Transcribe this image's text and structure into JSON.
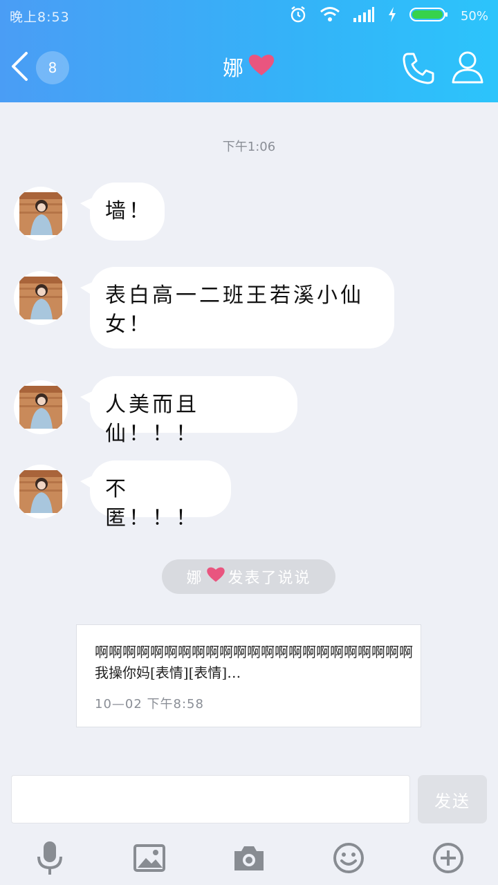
{
  "status": {
    "time": "晚上8:53",
    "battery_percent": "50%",
    "battery_level": 0.5
  },
  "header": {
    "unread_count": "8",
    "contact_name": "娜",
    "name_emoji_icon": "heart-icon"
  },
  "chat": {
    "timestamp": "下午1:06",
    "messages": [
      {
        "text": "墙！"
      },
      {
        "text": "表白高一二班王若溪小仙女！"
      },
      {
        "text": "人美而且仙！！！"
      },
      {
        "text": "不匿！！！"
      }
    ],
    "system_notice": {
      "name": "娜",
      "action": "发表了说说"
    },
    "feed_card": {
      "text": "啊啊啊啊啊啊啊啊啊啊啊啊啊啊啊啊啊啊啊啊啊啊啊我操你妈[表情][表情]…",
      "time": "10—02  下午8:58"
    }
  },
  "composer": {
    "send_label": "发送",
    "input_value": ""
  },
  "toolbar": {
    "icons": [
      "microphone-icon",
      "image-icon",
      "camera-icon",
      "emoji-icon",
      "plus-icon"
    ]
  },
  "colors": {
    "header_start": "#4a9df5",
    "header_end": "#2cc4fb",
    "heart": "#e9557f",
    "background": "#eef0f6"
  }
}
